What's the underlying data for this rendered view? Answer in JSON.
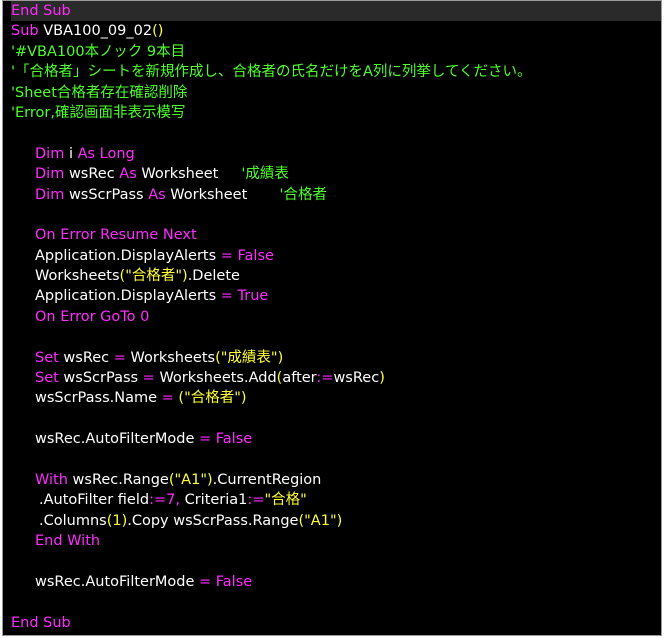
{
  "colors": {
    "background": "#000000",
    "keyword": "#ff2cff",
    "identifier": "#ffffff",
    "string": "#ffff33",
    "comment": "#4cff2a"
  },
  "code": {
    "lines": [
      {
        "indent": 0,
        "tokens": [
          {
            "t": "kw",
            "v": "End Sub"
          }
        ]
      },
      {
        "indent": 0,
        "tokens": [
          {
            "t": "kw",
            "v": "Sub "
          },
          {
            "t": "txt",
            "v": "VBA100_09_02"
          },
          {
            "t": "str",
            "v": "()"
          }
        ]
      },
      {
        "indent": 0,
        "tokens": [
          {
            "t": "cm",
            "v": "'#VBA100本ノック 9本目"
          }
        ]
      },
      {
        "indent": 0,
        "tokens": [
          {
            "t": "cm",
            "v": "'「合格者」シートを新規作成し、合格者の氏名だけをA列に列挙してください。"
          }
        ]
      },
      {
        "indent": 0,
        "tokens": [
          {
            "t": "cm",
            "v": "'Sheet合格者存在確認削除"
          }
        ]
      },
      {
        "indent": 0,
        "tokens": [
          {
            "t": "cm",
            "v": "'Error,確認画面非表示模写"
          }
        ]
      },
      {
        "indent": 0,
        "tokens": []
      },
      {
        "indent": 1,
        "tokens": [
          {
            "t": "kw",
            "v": "Dim "
          },
          {
            "t": "txt",
            "v": "i "
          },
          {
            "t": "kw",
            "v": "As Long"
          }
        ]
      },
      {
        "indent": 1,
        "tokens": [
          {
            "t": "kw",
            "v": "Dim "
          },
          {
            "t": "txt",
            "v": "wsRec "
          },
          {
            "t": "kw",
            "v": "As "
          },
          {
            "t": "txt",
            "v": "Worksheet     "
          },
          {
            "t": "cm",
            "v": "'成績表"
          }
        ]
      },
      {
        "indent": 1,
        "tokens": [
          {
            "t": "kw",
            "v": "Dim "
          },
          {
            "t": "txt",
            "v": "wsScrPass "
          },
          {
            "t": "kw",
            "v": "As "
          },
          {
            "t": "txt",
            "v": "Worksheet       "
          },
          {
            "t": "cm",
            "v": "'合格者"
          }
        ]
      },
      {
        "indent": 0,
        "tokens": []
      },
      {
        "indent": 1,
        "tokens": [
          {
            "t": "kw",
            "v": "On Error Resume Next"
          }
        ]
      },
      {
        "indent": 1,
        "tokens": [
          {
            "t": "txt",
            "v": "Application.DisplayAlerts "
          },
          {
            "t": "kw",
            "v": "= False"
          }
        ]
      },
      {
        "indent": 1,
        "tokens": [
          {
            "t": "txt",
            "v": "Worksheets"
          },
          {
            "t": "str",
            "v": "(\"合格者\")"
          },
          {
            "t": "txt",
            "v": ".Delete"
          }
        ]
      },
      {
        "indent": 1,
        "tokens": [
          {
            "t": "txt",
            "v": "Application.DisplayAlerts "
          },
          {
            "t": "kw",
            "v": "= True"
          }
        ]
      },
      {
        "indent": 1,
        "tokens": [
          {
            "t": "kw",
            "v": "On Error GoTo 0"
          }
        ]
      },
      {
        "indent": 0,
        "tokens": []
      },
      {
        "indent": 1,
        "tokens": [
          {
            "t": "kw",
            "v": "Set "
          },
          {
            "t": "txt",
            "v": "wsRec "
          },
          {
            "t": "kw",
            "v": "= "
          },
          {
            "t": "txt",
            "v": "Worksheets"
          },
          {
            "t": "str",
            "v": "(\"成績表\")"
          }
        ]
      },
      {
        "indent": 1,
        "tokens": [
          {
            "t": "kw",
            "v": "Set "
          },
          {
            "t": "txt",
            "v": "wsScrPass "
          },
          {
            "t": "kw",
            "v": "= "
          },
          {
            "t": "txt",
            "v": "Worksheets.Add"
          },
          {
            "t": "str",
            "v": "("
          },
          {
            "t": "txt",
            "v": "after"
          },
          {
            "t": "kw",
            "v": ":="
          },
          {
            "t": "txt",
            "v": "wsRec"
          },
          {
            "t": "str",
            "v": ")"
          }
        ]
      },
      {
        "indent": 1,
        "tokens": [
          {
            "t": "txt",
            "v": "wsScrPass.Name "
          },
          {
            "t": "kw",
            "v": "= "
          },
          {
            "t": "str",
            "v": "(\"合格者\")"
          }
        ]
      },
      {
        "indent": 0,
        "tokens": []
      },
      {
        "indent": 1,
        "tokens": [
          {
            "t": "txt",
            "v": "wsRec.AutoFilterMode "
          },
          {
            "t": "kw",
            "v": "= False"
          }
        ]
      },
      {
        "indent": 0,
        "tokens": []
      },
      {
        "indent": 1,
        "tokens": [
          {
            "t": "kw",
            "v": "With "
          },
          {
            "t": "txt",
            "v": "wsRec.Range"
          },
          {
            "t": "str",
            "v": "(\"A1\")"
          },
          {
            "t": "txt",
            "v": ".CurrentRegion"
          }
        ]
      },
      {
        "indent": 2,
        "tokens": [
          {
            "t": "txt",
            "v": ".AutoFilter field"
          },
          {
            "t": "kw",
            "v": ":=7, "
          },
          {
            "t": "txt",
            "v": "Criteria1"
          },
          {
            "t": "kw",
            "v": ":="
          },
          {
            "t": "str",
            "v": "\"合格\""
          }
        ]
      },
      {
        "indent": 2,
        "tokens": [
          {
            "t": "txt",
            "v": ".Columns"
          },
          {
            "t": "str",
            "v": "(1)"
          },
          {
            "t": "txt",
            "v": ".Copy wsScrPass.Range"
          },
          {
            "t": "str",
            "v": "(\"A1\")"
          }
        ]
      },
      {
        "indent": 1,
        "tokens": [
          {
            "t": "kw",
            "v": "End With"
          }
        ]
      },
      {
        "indent": 0,
        "tokens": []
      },
      {
        "indent": 1,
        "tokens": [
          {
            "t": "txt",
            "v": "wsRec.AutoFilterMode "
          },
          {
            "t": "kw",
            "v": "= False"
          }
        ]
      },
      {
        "indent": 0,
        "tokens": []
      },
      {
        "indent": 0,
        "tokens": [
          {
            "t": "kw",
            "v": "End Sub"
          }
        ]
      }
    ]
  }
}
